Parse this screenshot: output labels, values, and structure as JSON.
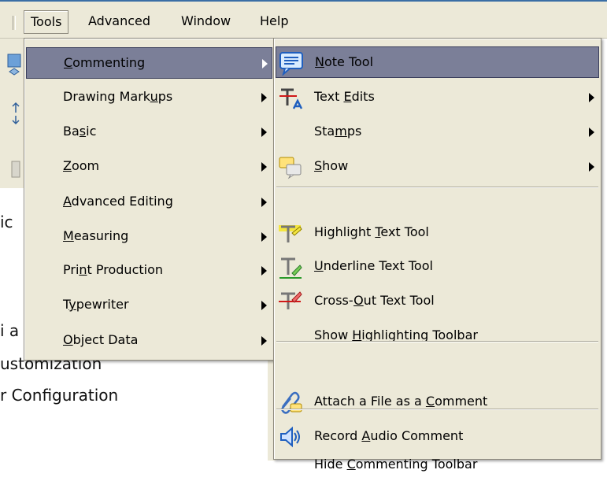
{
  "menubar": {
    "items": [
      {
        "label": "Tools",
        "active": true
      },
      {
        "label": "Advanced"
      },
      {
        "label": "Window"
      },
      {
        "label": "Help"
      }
    ]
  },
  "background": {
    "lines": [
      "ic",
      "i a",
      "ustomization",
      "r Configuration"
    ]
  },
  "tools_menu": {
    "items": [
      {
        "pre": "",
        "ul": "C",
        "post": "ommenting",
        "highlighted": true,
        "submenu": true
      },
      {
        "pre": "Drawing Mark",
        "ul": "u",
        "post": "ps",
        "submenu": true
      },
      {
        "pre": "Ba",
        "ul": "s",
        "post": "ic",
        "submenu": true
      },
      {
        "pre": "",
        "ul": "Z",
        "post": "oom",
        "submenu": true
      },
      {
        "pre": "",
        "ul": "A",
        "post": "dvanced Editing",
        "submenu": true
      },
      {
        "pre": "",
        "ul": "M",
        "post": "easuring",
        "submenu": true
      },
      {
        "pre": "Pri",
        "ul": "n",
        "post": "t Production",
        "submenu": true
      },
      {
        "pre": "T",
        "ul": "y",
        "post": "pewriter",
        "submenu": true
      },
      {
        "pre": "",
        "ul": "O",
        "post": "bject Data",
        "submenu": true
      }
    ]
  },
  "commenting_menu": {
    "items": [
      {
        "pre": "",
        "ul": "N",
        "post": "ote Tool",
        "icon": "note-icon",
        "highlighted": true
      },
      {
        "pre": "Text ",
        "ul": "E",
        "post": "dits",
        "icon": "text-edits-icon",
        "submenu": true
      },
      {
        "pre": "Sta",
        "ul": "m",
        "post": "ps",
        "icon": "",
        "submenu": true
      },
      {
        "pre": "",
        "ul": "S",
        "post": "how",
        "icon": "show-comments-icon",
        "submenu": true
      },
      {
        "pre": "Highlight ",
        "ul": "T",
        "post": "ext Tool",
        "icon": "highlight-text-icon"
      },
      {
        "pre": "",
        "ul": "U",
        "post": "nderline Text Tool",
        "icon": "underline-text-icon"
      },
      {
        "pre": "Cross-",
        "ul": "O",
        "post": "ut Text Tool",
        "icon": "cross-out-text-icon"
      },
      {
        "pre": "Show ",
        "ul": "H",
        "post": "ighlighting Toolbar",
        "icon": ""
      },
      {
        "pre": "Attach a File as a ",
        "ul": "C",
        "post": "omment",
        "icon": "attach-file-icon"
      },
      {
        "pre": "Record ",
        "ul": "A",
        "post": "udio Comment",
        "icon": "speaker-icon"
      },
      {
        "pre": "Hide ",
        "ul": "C",
        "post": "ommenting Toolbar",
        "icon": ""
      }
    ]
  },
  "colors": {
    "menu_bg": "#ece9d8",
    "highlight": "#7b7f98",
    "titlebar_accent": "#3a6ea5"
  }
}
